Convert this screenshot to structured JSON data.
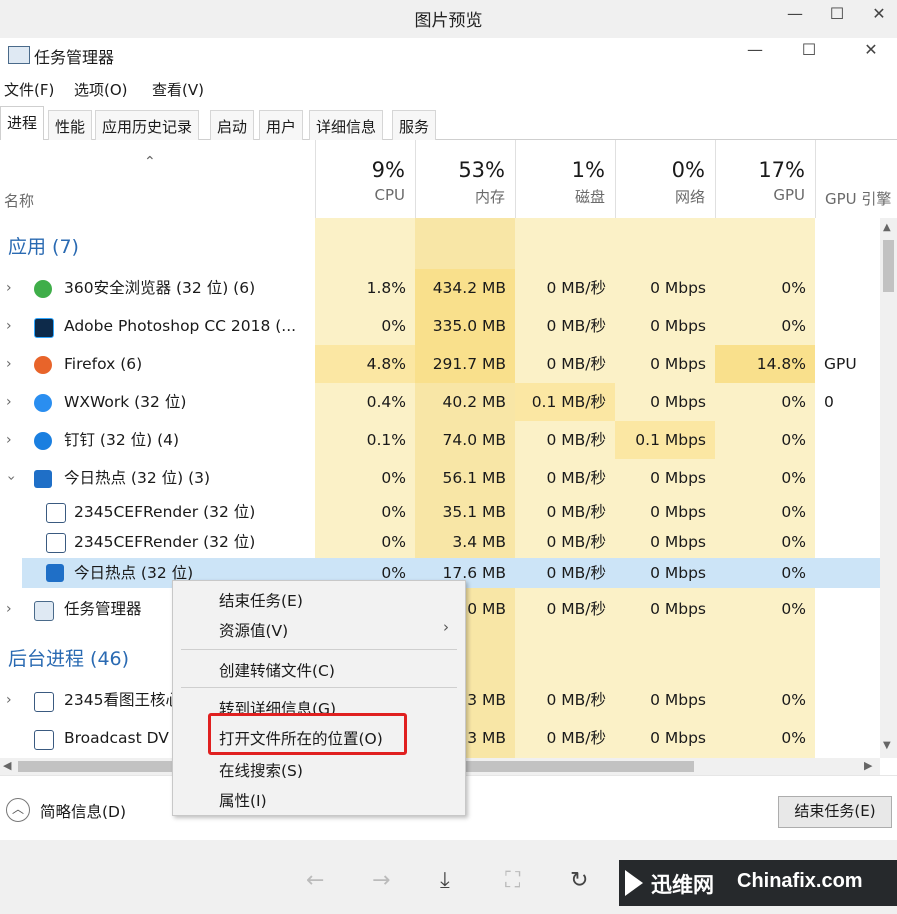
{
  "viewer": {
    "title": "图片预览"
  },
  "window": {
    "title": "任务管理器"
  },
  "menu": [
    "文件(F)",
    "选项(O)",
    "查看(V)"
  ],
  "tabs": [
    "进程",
    "性能",
    "应用历史记录",
    "启动",
    "用户",
    "详细信息",
    "服务"
  ],
  "columns": {
    "name": "名称",
    "cpu": {
      "pct": "9%",
      "label": "CPU"
    },
    "mem": {
      "pct": "53%",
      "label": "内存"
    },
    "disk": {
      "pct": "1%",
      "label": "磁盘"
    },
    "net": {
      "pct": "0%",
      "label": "网络"
    },
    "gpu": {
      "pct": "17%",
      "label": "GPU"
    },
    "gpu_engine": {
      "label": "GPU 引擎"
    }
  },
  "groups": {
    "apps": "应用 (7)",
    "background": "后台进程 (46)"
  },
  "rows": [
    {
      "name": "360安全浏览器 (32 位) (6)",
      "cpu": "1.8%",
      "mem": "434.2 MB",
      "disk": "0 MB/秒",
      "net": "0 Mbps",
      "gpu": "0%",
      "eng": ""
    },
    {
      "name": "Adobe Photoshop CC 2018 (...",
      "cpu": "0%",
      "mem": "335.0 MB",
      "disk": "0 MB/秒",
      "net": "0 Mbps",
      "gpu": "0%",
      "eng": ""
    },
    {
      "name": "Firefox (6)",
      "cpu": "4.8%",
      "mem": "291.7 MB",
      "disk": "0 MB/秒",
      "net": "0 Mbps",
      "gpu": "14.8%",
      "eng": "GPU 0"
    },
    {
      "name": "WXWork (32 位)",
      "cpu": "0.4%",
      "mem": "40.2 MB",
      "disk": "0.1 MB/秒",
      "net": "0 Mbps",
      "gpu": "0%",
      "eng": ""
    },
    {
      "name": "钉钉 (32 位) (4)",
      "cpu": "0.1%",
      "mem": "74.0 MB",
      "disk": "0 MB/秒",
      "net": "0.1 Mbps",
      "gpu": "0%",
      "eng": ""
    },
    {
      "name": "今日热点 (32 位) (3)",
      "cpu": "0%",
      "mem": "56.1 MB",
      "disk": "0 MB/秒",
      "net": "0 Mbps",
      "gpu": "0%",
      "eng": ""
    },
    {
      "name": "2345CEFRender (32 位)",
      "cpu": "0%",
      "mem": "35.1 MB",
      "disk": "0 MB/秒",
      "net": "0 Mbps",
      "gpu": "0%",
      "eng": ""
    },
    {
      "name": "2345CEFRender (32 位)",
      "cpu": "0%",
      "mem": "3.4 MB",
      "disk": "0 MB/秒",
      "net": "0 Mbps",
      "gpu": "0%",
      "eng": ""
    },
    {
      "name": "今日热点 (32 位)",
      "cpu": "0%",
      "mem": "17.6 MB",
      "disk": "0 MB/秒",
      "net": "0 Mbps",
      "gpu": "0%",
      "eng": ""
    },
    {
      "name": "任务管理器",
      "cpu": "",
      "mem": "0 MB",
      "disk": "0 MB/秒",
      "net": "0 Mbps",
      "gpu": "0%",
      "eng": ""
    },
    {
      "name": "2345看图王核心",
      "cpu": "",
      "mem": "3 MB",
      "disk": "0 MB/秒",
      "net": "0 Mbps",
      "gpu": "0%",
      "eng": ""
    },
    {
      "name": "Broadcast DV",
      "cpu": "",
      "mem": "3 MB",
      "disk": "0 MB/秒",
      "net": "0 Mbps",
      "gpu": "0%",
      "eng": ""
    }
  ],
  "context_menu": {
    "end_task": "结束任务(E)",
    "resource": "资源值(V)",
    "dump": "创建转储文件(C)",
    "details": "转到详细信息(G)",
    "open_location": "打开文件所在的位置(O)",
    "search_online": "在线搜索(S)",
    "properties": "属性(I)"
  },
  "footer": {
    "fewer": "简略信息(D)",
    "end_task": "结束任务(E)"
  },
  "brand": {
    "cn": "迅维网",
    "en": "Chinafix.com"
  }
}
